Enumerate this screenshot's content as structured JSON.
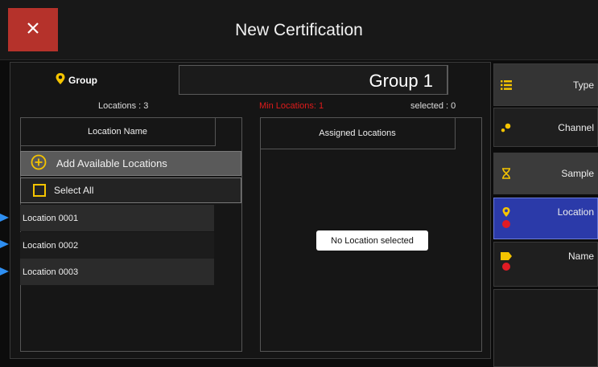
{
  "dialog": {
    "title": "New Certification"
  },
  "group": {
    "label": "Group",
    "value": "Group 1",
    "locations_count": "Locations : 3",
    "min_locations": "Min Locations: 1",
    "selected": "selected : 0"
  },
  "left_list": {
    "header": "Location Name",
    "add_label": "Add Available Locations",
    "select_all_label": "Select All",
    "items": [
      "Location 0001",
      "Location 0002",
      "Location 0003"
    ]
  },
  "right_list": {
    "header": "Assigned Locations",
    "empty_message": "No Location selected"
  },
  "side_nav": {
    "items": [
      {
        "label": "Type",
        "icon": "list-icon"
      },
      {
        "label": "Channel",
        "icon": "channel-icon"
      },
      {
        "label": "Sample",
        "icon": "hourglass-icon"
      },
      {
        "label": "Location",
        "icon": "location-pin-icon"
      },
      {
        "label": "Name",
        "icon": "tag-icon"
      }
    ]
  },
  "colors": {
    "accent": "#f5c400",
    "close_button": "#b5322b",
    "selected_nav": "#2b3aa9",
    "error": "#e01b24",
    "arrow": "#2e8ff2"
  }
}
